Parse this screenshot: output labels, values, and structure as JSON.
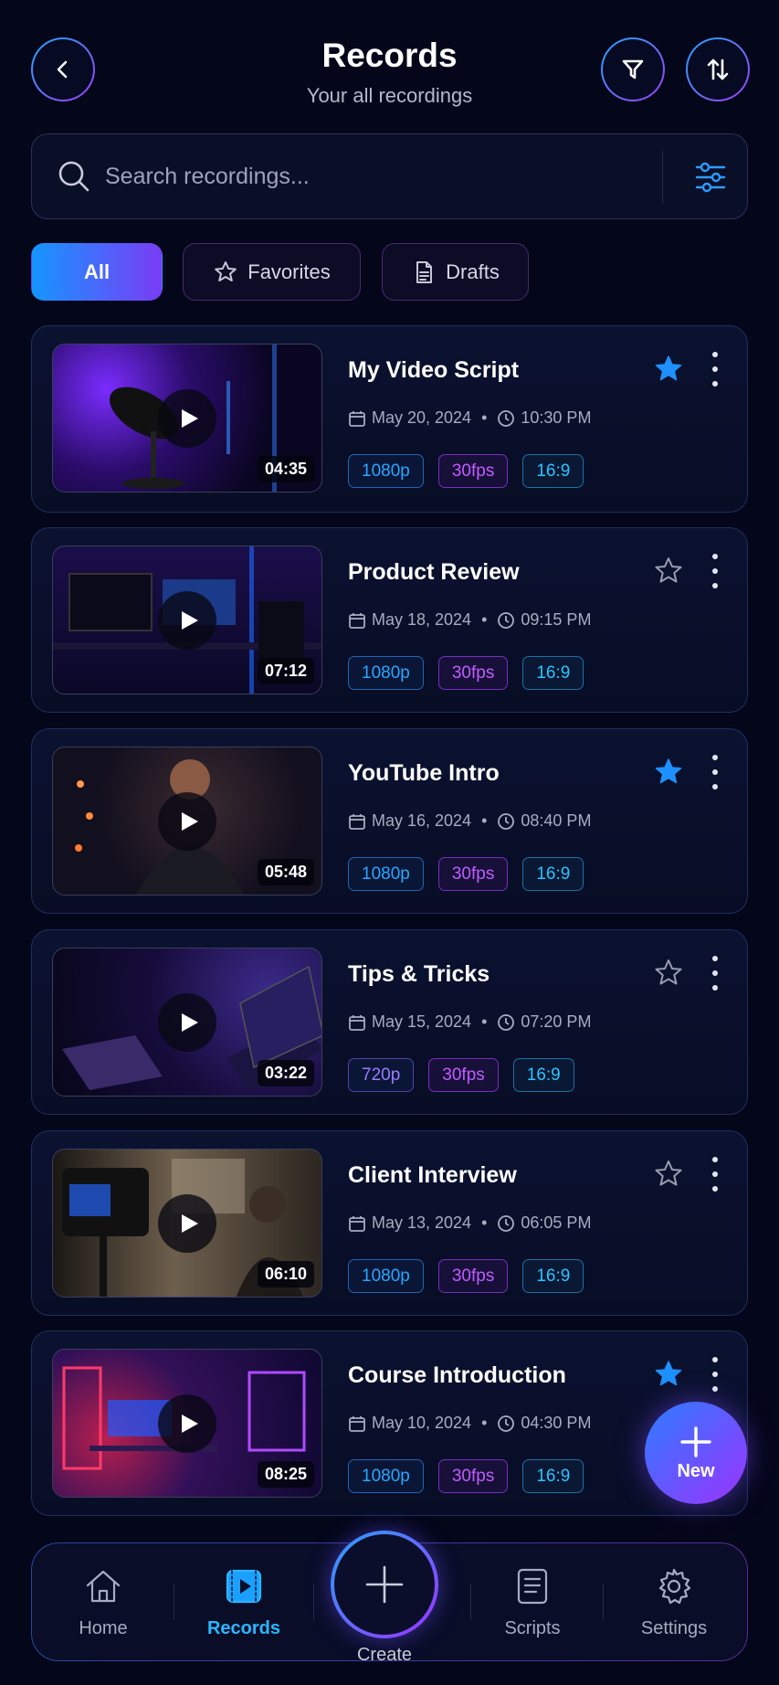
{
  "header": {
    "title": "Records",
    "subtitle": "Your all recordings",
    "back_icon": "chevron-left-icon",
    "filter_icon": "filter-icon",
    "sort_icon": "sort-icon"
  },
  "search": {
    "placeholder": "Search recordings...",
    "icon": "search-icon",
    "filter_icon": "sliders-icon"
  },
  "tabs": [
    {
      "label": "All",
      "active": true
    },
    {
      "label": "Favorites",
      "icon": "star-outline-icon"
    },
    {
      "label": "Drafts",
      "icon": "document-icon"
    }
  ],
  "recordings": [
    {
      "title": "My Video Script",
      "date": "May 20, 2024",
      "time": "10:30 PM",
      "duration": "04:35",
      "resolution": "1080p",
      "fps": "30fps",
      "aspect": "16:9",
      "favorite": true
    },
    {
      "title": "Product Review",
      "date": "May 18, 2024",
      "time": "09:15 PM",
      "duration": "07:12",
      "resolution": "1080p",
      "fps": "30fps",
      "aspect": "16:9",
      "favorite": false
    },
    {
      "title": "YouTube Intro",
      "date": "May 16, 2024",
      "time": "08:40 PM",
      "duration": "05:48",
      "resolution": "1080p",
      "fps": "30fps",
      "aspect": "16:9",
      "favorite": true
    },
    {
      "title": "Tips & Tricks",
      "date": "May 15, 2024",
      "time": "07:20 PM",
      "duration": "03:22",
      "resolution": "720p",
      "fps": "30fps",
      "aspect": "16:9",
      "favorite": false
    },
    {
      "title": "Client Interview",
      "date": "May 13, 2024",
      "time": "06:05 PM",
      "duration": "06:10",
      "resolution": "1080p",
      "fps": "30fps",
      "aspect": "16:9",
      "favorite": false
    },
    {
      "title": "Course Introduction",
      "date": "May 10, 2024",
      "time": "04:30 PM",
      "duration": "08:25",
      "resolution": "1080p",
      "fps": "30fps",
      "aspect": "16:9",
      "favorite": true
    }
  ],
  "fab": {
    "label": "New",
    "icon": "plus-icon"
  },
  "nav": {
    "home": "Home",
    "records": "Records",
    "create": "Create",
    "scripts": "Scripts",
    "settings": "Settings"
  },
  "colors": {
    "background": "#04061a",
    "accent_blue": "#2aa6ff",
    "accent_purple": "#9b33ff",
    "favorite_star": "#1e90ff"
  }
}
